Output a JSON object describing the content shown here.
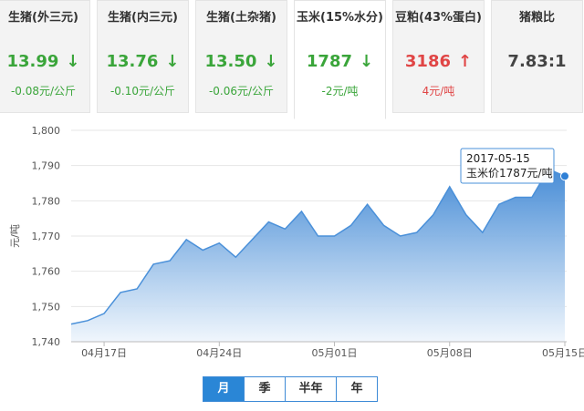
{
  "cards": [
    {
      "title": "生猪(外三元)",
      "price": "13.99",
      "change": "-0.08元/公斤",
      "trend": "down"
    },
    {
      "title": "生猪(内三元)",
      "price": "13.76",
      "change": "-0.10元/公斤",
      "trend": "down"
    },
    {
      "title": "生猪(土杂猪)",
      "price": "13.50",
      "change": "-0.06元/公斤",
      "trend": "down"
    },
    {
      "title": "玉米(15%水分)",
      "price": "1787",
      "change": "-2元/吨",
      "trend": "down"
    },
    {
      "title": "豆粕(43%蛋白)",
      "price": "3186",
      "change": "4元/吨",
      "trend": "up"
    },
    {
      "title": "猪粮比",
      "price": "7.83:1",
      "change": "",
      "trend": "none"
    }
  ],
  "arrows": {
    "down": "↓",
    "up": "↑"
  },
  "chart_data": {
    "type": "area",
    "ylabel": "元/吨",
    "ylim": [
      1740,
      1800
    ],
    "y_ticks": [
      "1,740",
      "1,750",
      "1,760",
      "1,770",
      "1,780",
      "1,790",
      "1,800"
    ],
    "x_ticks": [
      "04月17日",
      "04月24日",
      "05月01日",
      "05月08日",
      "05月15日"
    ],
    "x": [
      "2017-04-15",
      "2017-04-16",
      "2017-04-17",
      "2017-04-18",
      "2017-04-19",
      "2017-04-20",
      "2017-04-21",
      "2017-04-22",
      "2017-04-23",
      "2017-04-24",
      "2017-04-25",
      "2017-04-26",
      "2017-04-27",
      "2017-04-28",
      "2017-04-29",
      "2017-04-30",
      "2017-05-01",
      "2017-05-02",
      "2017-05-03",
      "2017-05-04",
      "2017-05-05",
      "2017-05-06",
      "2017-05-07",
      "2017-05-08",
      "2017-05-09",
      "2017-05-10",
      "2017-05-11",
      "2017-05-12",
      "2017-05-13",
      "2017-05-14",
      "2017-05-15"
    ],
    "values": [
      1745,
      1746,
      1748,
      1754,
      1755,
      1762,
      1763,
      1769,
      1766,
      1768,
      1764,
      1769,
      1774,
      1772,
      1777,
      1770,
      1770,
      1773,
      1779,
      1773,
      1770,
      1771,
      1776,
      1784,
      1776,
      1771,
      1779,
      1781,
      1781,
      1789,
      1787
    ],
    "tooltip": {
      "date": "2017-05-15",
      "text": "玉米价1787元/吨"
    },
    "colors": {
      "line": "#4a90d9",
      "fill_top": "#3d86d4",
      "fill_bottom": "#eef5fc",
      "grid": "#e6e6e6"
    }
  },
  "tabs": [
    "月",
    "季",
    "半年",
    "年"
  ],
  "active_tab": 0
}
